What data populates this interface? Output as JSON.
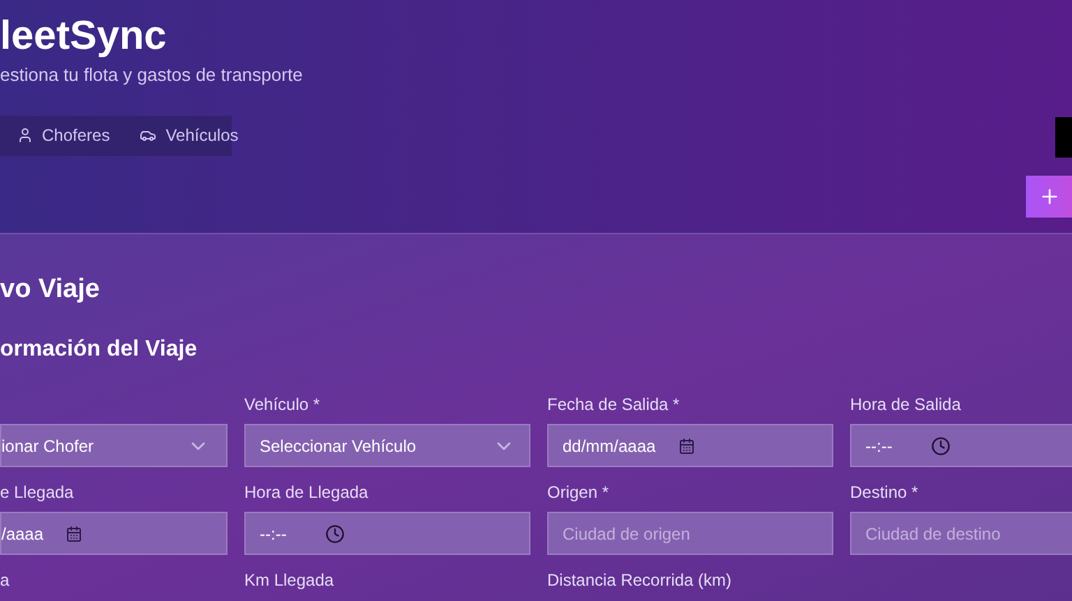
{
  "header": {
    "title": "leetSync",
    "subtitle": "estiona tu flota y gastos de transporte"
  },
  "tabs": [
    {
      "label": "Choferes",
      "kind": "person",
      "selected": false
    },
    {
      "label": "Vehículos",
      "kind": "car",
      "selected": false
    }
  ],
  "form": {
    "title": "vo Viaje",
    "section": "ormación del Viaje",
    "rows": [
      [
        {
          "kind": "select",
          "value": "ionar Chofer"
        },
        {
          "label": "Vehículo *",
          "kind": "select",
          "value": "Seleccionar Vehículo"
        },
        {
          "label": "Fecha de Salida *",
          "kind": "date",
          "value": "dd/mm/aaaa"
        },
        {
          "label": "Hora de Salida",
          "kind": "time",
          "value": "--:--"
        }
      ],
      [
        {
          "label": "e Llegada",
          "kind": "date",
          "value": "/aaaa"
        },
        {
          "label": "Hora de Llegada",
          "kind": "time",
          "value": "--:--"
        },
        {
          "label": "Origen *",
          "kind": "text",
          "placeholder": "Ciudad de origen"
        },
        {
          "label": "Destino *",
          "kind": "text",
          "placeholder": "Ciudad de destino"
        }
      ],
      [
        {
          "label": "a",
          "kind": "hidden"
        },
        {
          "label": "Km Llegada",
          "kind": "hidden"
        },
        {
          "label": "Distancia Recorrida (km)",
          "kind": "hidden"
        }
      ]
    ]
  }
}
